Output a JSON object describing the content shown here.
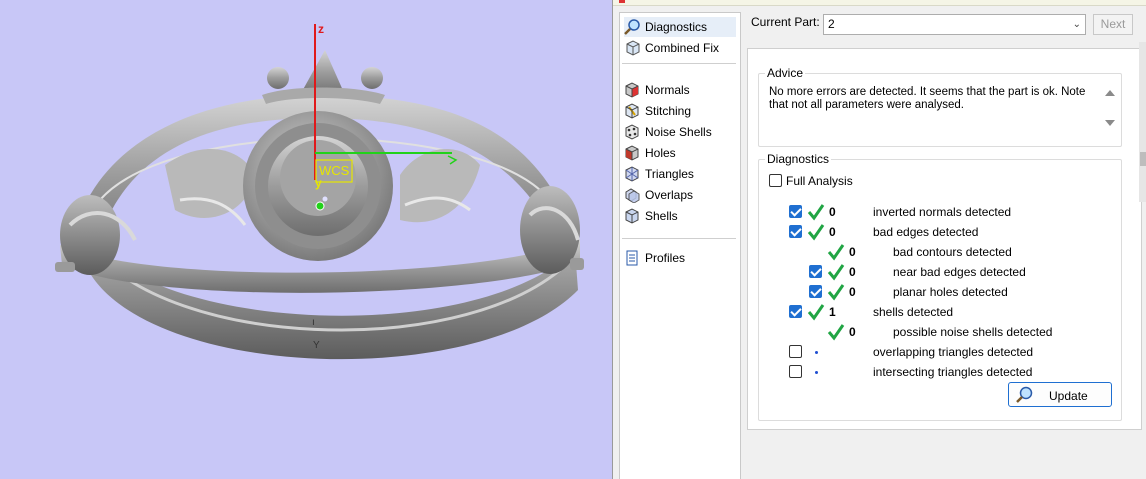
{
  "viewport": {
    "axis_z_label": "z",
    "axis_y_label": "y",
    "wcs_label": "WCS",
    "colors": {
      "background": "#c8c7f7",
      "axis_z": "#e0191b",
      "axis_x": "#22d21a",
      "wcs_box": "#e6e600"
    }
  },
  "nav": {
    "items": [
      {
        "label": "Diagnostics",
        "icon": "magnifier-icon"
      },
      {
        "label": "Combined Fix",
        "icon": "cube-fix-icon"
      },
      {
        "label": "Normals",
        "icon": "normals-cube-icon"
      },
      {
        "label": "Stitching",
        "icon": "stitching-icon"
      },
      {
        "label": "Noise Shells",
        "icon": "noise-shells-icon"
      },
      {
        "label": "Holes",
        "icon": "holes-cube-icon"
      },
      {
        "label": "Triangles",
        "icon": "triangles-icon"
      },
      {
        "label": "Overlaps",
        "icon": "overlaps-icon"
      },
      {
        "label": "Shells",
        "icon": "shells-icon"
      },
      {
        "label": "Profiles",
        "icon": "profiles-icon"
      }
    ]
  },
  "header": {
    "current_part_label": "Current Part:",
    "current_part_value": "2",
    "next_label": "Next"
  },
  "advice": {
    "title": "Advice",
    "text_line1": "No more errors are detected. It seems that the part is ok. Note",
    "text_line2": "that not all parameters were analysed."
  },
  "diagnostics": {
    "title": "Diagnostics",
    "full_analysis_label": "Full Analysis",
    "rows": [
      {
        "count": "0",
        "label": "inverted normals detected"
      },
      {
        "count": "0",
        "label": "bad edges detected"
      },
      {
        "count": "0",
        "label": "bad contours detected"
      },
      {
        "count": "0",
        "label": "near bad edges detected"
      },
      {
        "count": "0",
        "label": "planar holes detected"
      },
      {
        "count": "1",
        "label": "shells detected"
      },
      {
        "count": "0",
        "label": "possible noise shells detected"
      },
      {
        "count": "",
        "label": "overlapping triangles detected"
      },
      {
        "count": "",
        "label": "intersecting triangles detected"
      }
    ],
    "update_label": "Update"
  }
}
